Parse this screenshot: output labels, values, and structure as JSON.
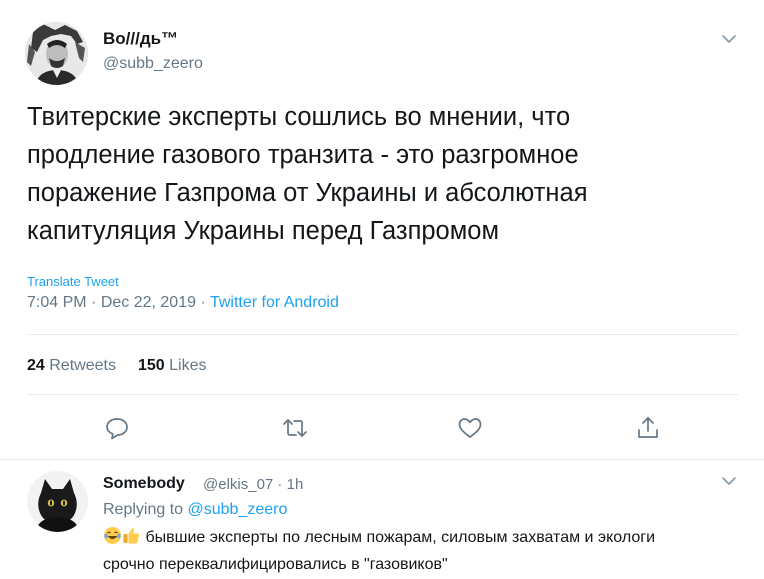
{
  "tweet": {
    "author_name": "Во///дь™",
    "author_handle": "@subb_zeero",
    "text": "Твитерские эксперты сошлись во мнении, что\nпродление газового транзита - это разгромное\nпоражение Газпрома от Украины и абсолютная\nкапитуляция Украины перед Газпромом",
    "translate_label": "Translate Tweet",
    "time": "7:04 PM",
    "date": "Dec 22, 2019",
    "separator": " · ",
    "source": "Twitter for Android",
    "retweets_count": "24",
    "retweets_label": "Retweets",
    "likes_count": "150",
    "likes_label": "Likes"
  },
  "icons": {
    "more": "chevron-down-icon",
    "reply": "reply-icon",
    "retweet": "retweet-icon",
    "like": "heart-icon",
    "share": "share-icon"
  },
  "reply": {
    "author_name": "Somebody",
    "author_handle": "@elkis_07",
    "time": "1h",
    "replying_prefix": "Replying to",
    "replying_to": "@subb_zeero",
    "text": "бывшие эксперты по лесным пожарам, силовым захватам и экологи срочно переквалифицировались в \"газовиков\""
  },
  "colors": {
    "accent": "#1da1f2",
    "secondary_text": "#657786",
    "border": "#e6ecf0"
  }
}
